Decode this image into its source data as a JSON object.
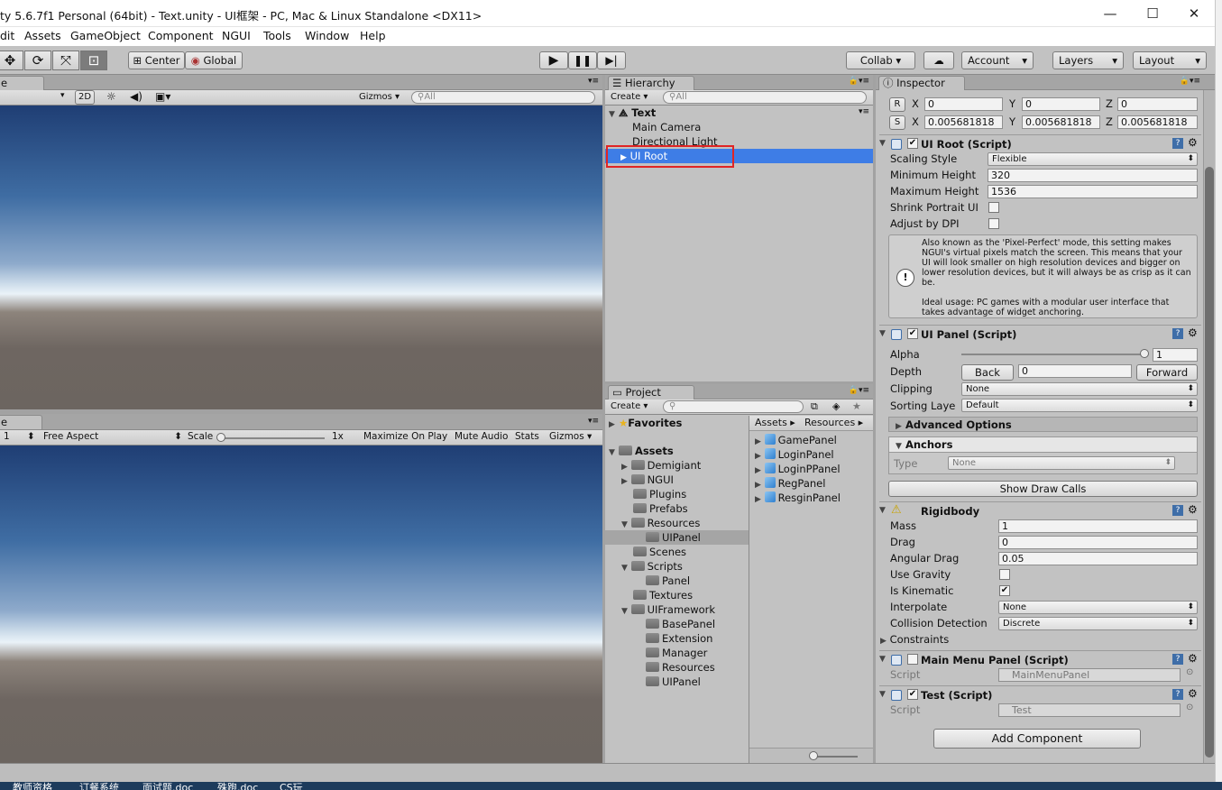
{
  "window": {
    "title": "ty 5.6.7f1 Personal (64bit) - Text.unity - UI框架 - PC, Mac & Linux Standalone <DX11>",
    "minimize": "—",
    "maximize": "☐",
    "close": "✕"
  },
  "menu": [
    "dit",
    "Assets",
    "GameObject",
    "Component",
    "NGUI",
    "Tools",
    "Window",
    "Help"
  ],
  "toolbar": {
    "pivot": "Center",
    "space": "Global",
    "play_icon": "play-icon",
    "pause_icon": "pause-icon",
    "step_icon": "step-icon",
    "collab": "Collab ▾",
    "account": "Account",
    "layers": "Layers",
    "layout": "Layout"
  },
  "scene": {
    "tab": "e",
    "mode2d": "2D",
    "gizmos": "Gizmos",
    "search_placeholder": "All"
  },
  "game": {
    "tab": "e",
    "display": "1",
    "aspect": "Free Aspect",
    "scale_label": "Scale",
    "scale_value": "1x",
    "maximize": "Maximize On Play",
    "mute": "Mute Audio",
    "stats": "Stats",
    "gizmos": "Gizmos"
  },
  "hierarchy": {
    "tab": "Hierarchy",
    "create": "Create",
    "search_placeholder": "All",
    "scene": "Text",
    "items": [
      "Main Camera",
      "Directional Light",
      "UI Root"
    ],
    "selected": "UI Root"
  },
  "project": {
    "tab": "Project",
    "create": "Create",
    "favorites": "Favorites",
    "tree": [
      "Assets",
      "Demigiant",
      "NGUI",
      "Plugins",
      "Prefabs",
      "Resources",
      "UIPanel",
      "Scenes",
      "Scripts",
      "Panel",
      "Textures",
      "UIFramework",
      "BasePanel",
      "Extension",
      "Manager",
      "Resources",
      "UIPanel"
    ],
    "breadcrumb": [
      "Assets",
      "Resources"
    ],
    "files": [
      "GamePanel",
      "LoginPanel",
      "LoginPPanel",
      "RegPanel",
      "ResginPanel"
    ]
  },
  "inspector": {
    "tab": "Inspector",
    "rotation": {
      "label": "R",
      "x": "0",
      "y": "0",
      "z": "0"
    },
    "scale": {
      "label": "S",
      "x": "0.005681818",
      "y": "0.005681818",
      "z": "0.005681818"
    },
    "ui_root": {
      "title": "UI Root (Script)",
      "scaling_style_label": "Scaling Style",
      "scaling_style": "Flexible",
      "min_height_label": "Minimum Height",
      "min_height": "320",
      "max_height_label": "Maximum Height",
      "max_height": "1536",
      "shrink_label": "Shrink Portrait UI",
      "dpi_label": "Adjust by DPI",
      "help1": "Also known as the 'Pixel-Perfect' mode, this setting makes NGUI's virtual pixels match the screen. This means that your UI will look smaller on high resolution devices and bigger on lower resolution devices, but it will always be as crisp as it can be.",
      "help2": "Ideal usage: PC games with a modular user interface that takes advantage of widget anchoring."
    },
    "ui_panel": {
      "title": "UI Panel (Script)",
      "alpha_label": "Alpha",
      "alpha": "1",
      "depth_label": "Depth",
      "back": "Back",
      "depth": "0",
      "forward": "Forward",
      "clipping_label": "Clipping",
      "clipping": "None",
      "sorting_label": "Sorting Laye",
      "sorting": "Default",
      "advanced": "Advanced Options",
      "anchors": "Anchors",
      "type_label": "Type",
      "type": "None",
      "draw_calls": "Show Draw Calls"
    },
    "rigidbody": {
      "title": "Rigidbody",
      "mass_label": "Mass",
      "mass": "1",
      "drag_label": "Drag",
      "drag": "0",
      "angular_label": "Angular Drag",
      "angular": "0.05",
      "gravity_label": "Use Gravity",
      "kinematic_label": "Is Kinematic",
      "interpolate_label": "Interpolate",
      "interpolate": "None",
      "collision_label": "Collision Detection",
      "collision": "Discrete",
      "constraints": "Constraints"
    },
    "main_menu": {
      "title": "Main Menu Panel (Script)",
      "script_label": "Script",
      "script": "MainMenuPanel"
    },
    "test": {
      "title": "Test (Script)",
      "script_label": "Script",
      "script": "Test"
    },
    "add_component": "Add Component"
  },
  "taskbar": [
    "教师资格",
    "订餐系统",
    "面试题.doc",
    "殊跑.doc",
    "CS玩"
  ],
  "colors": {
    "selection": "#3e7de6",
    "highlight_box": "#e02424",
    "panel": "#c2c2c2"
  }
}
